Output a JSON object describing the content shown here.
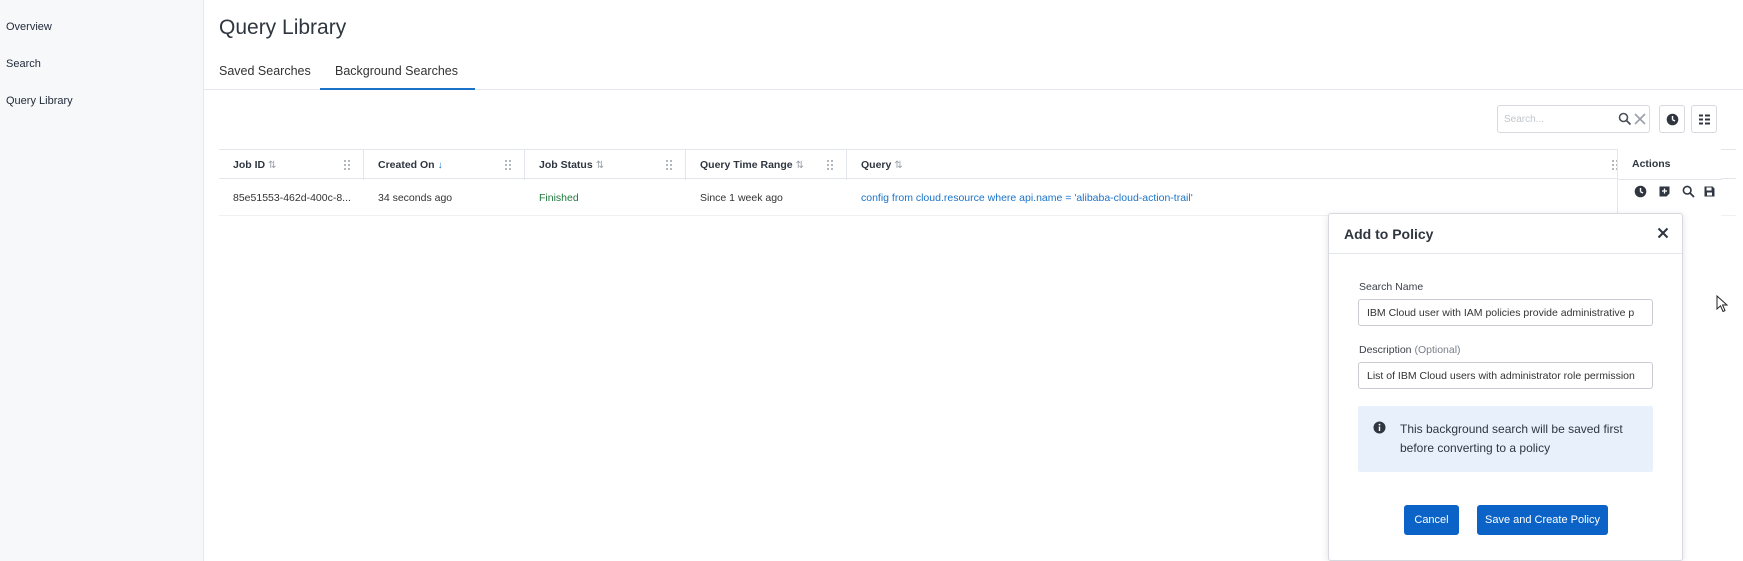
{
  "sidebar": {
    "items": [
      {
        "label": "Overview"
      },
      {
        "label": "Search"
      },
      {
        "label": "Query Library"
      }
    ]
  },
  "page": {
    "title": "Query Library"
  },
  "tabs": [
    {
      "label": "Saved Searches",
      "active": false
    },
    {
      "label": "Background Searches",
      "active": true
    }
  ],
  "toolbar": {
    "search_placeholder": "Search...",
    "search_icon": "magnifier-icon",
    "clear_icon": "close-icon",
    "history_icon": "clock-icon",
    "columns_icon": "columns-icon"
  },
  "table": {
    "columns": [
      {
        "label": "Job ID",
        "sort": "⇅"
      },
      {
        "label": "Created On",
        "sort": "↓"
      },
      {
        "label": "Job Status",
        "sort": "⇅"
      },
      {
        "label": "Query Time Range",
        "sort": "⇅"
      },
      {
        "label": "Query",
        "sort": "⇅"
      },
      {
        "label": "Actions"
      }
    ],
    "rows": [
      {
        "job_id": "85e51553-462d-400c-8...",
        "created_on": "34 seconds ago",
        "job_status": "Finished",
        "time_range": "Since 1 week ago",
        "query": "config from cloud.resource where api.name = 'alibaba-cloud-action-trail'"
      }
    ],
    "row_actions": [
      "clock-icon",
      "add-to-policy-icon",
      "search-icon",
      "save-icon"
    ]
  },
  "dialog": {
    "title": "Add to Policy",
    "search_name_label": "Search Name",
    "search_name_value": "IBM Cloud user with IAM policies provide administrative p",
    "description_label": "Description",
    "description_optional": "(Optional)",
    "description_value": "List of IBM Cloud users with administrator role permission",
    "info_text": "This background search will be saved first before converting to a policy",
    "cancel_label": "Cancel",
    "save_label": "Save and Create Policy"
  },
  "colors": {
    "accent": "#0b63c7",
    "link": "#1a73c9",
    "status_finished": "#1f7a3d",
    "info_bg": "#e8f1fb"
  }
}
